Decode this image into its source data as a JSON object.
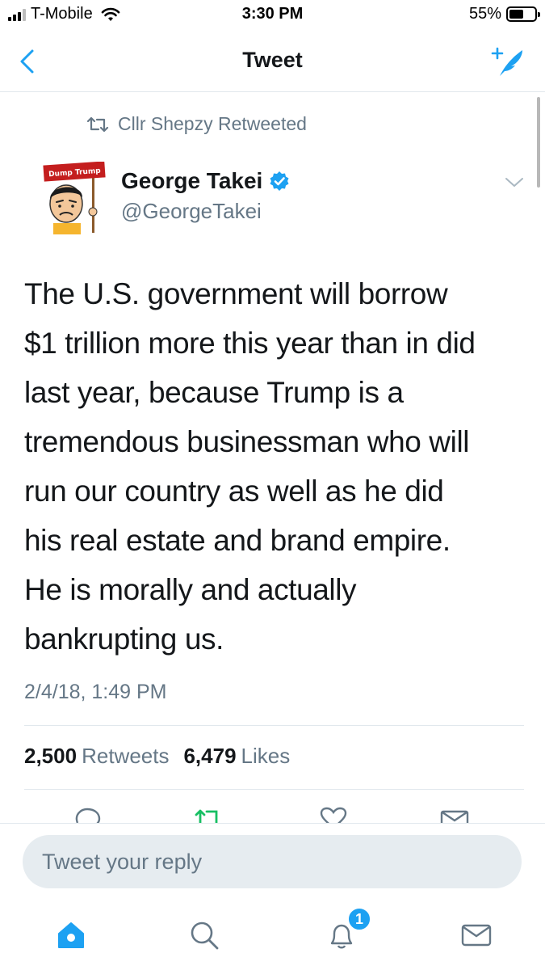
{
  "status_bar": {
    "carrier": "T-Mobile",
    "time": "3:30 PM",
    "battery_percent": "55%",
    "battery_level": 0.55,
    "signal_bars": 3,
    "signal_bars_total": 4
  },
  "nav": {
    "title": "Tweet",
    "back_icon": "chevron-left-icon",
    "compose_icon": "compose-tweet-icon"
  },
  "tweet": {
    "retweet_context": "Cllr Shepzy Retweeted",
    "author": {
      "name": "George Takei",
      "handle": "@GeorgeTakei",
      "verified": true,
      "avatar_sign_text": "Dump Trump"
    },
    "text_lines": [
      "The U.S. government will borrow",
      "$1 trillion more this year than in did",
      "last year, because Trump is a",
      "tremendous businessman who will",
      "run our country as well as he did",
      "his real estate and brand empire.",
      "He is morally and actually",
      "bankrupting us."
    ],
    "timestamp": "2/4/18, 1:49 PM",
    "stats": {
      "retweets_count": "2,500",
      "retweets_label": "Retweets",
      "likes_count": "6,479",
      "likes_label": "Likes"
    },
    "actions": [
      "reply-icon",
      "retweet-icon",
      "like-icon",
      "share-icon"
    ]
  },
  "reply": {
    "placeholder": "Tweet your reply"
  },
  "tab_bar": {
    "items": [
      "home-icon",
      "search-icon",
      "notifications-icon",
      "messages-icon"
    ],
    "notifications_badge": "1"
  },
  "colors": {
    "accent": "#1da1f2",
    "retweet_green": "#17bf63",
    "text_primary": "#14171a",
    "text_secondary": "#657786",
    "divider": "#e1e8ed",
    "reply_bg": "#e6ecf0"
  }
}
